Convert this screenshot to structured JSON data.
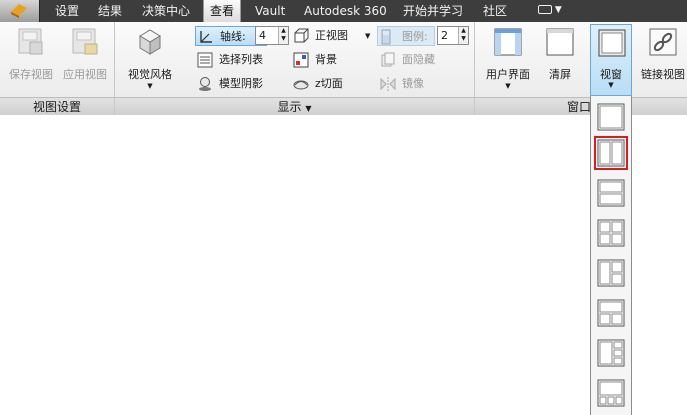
{
  "menu": {
    "items": [
      "设置",
      "结果",
      "决策中心",
      "查看",
      "Vault",
      "Autodesk 360",
      "开始并学习",
      "社区"
    ],
    "active": "查看"
  },
  "panels": {
    "view_settings": {
      "title": "视图设置",
      "save_view": "保存视图",
      "apply_view": "应用视图"
    },
    "display": {
      "title": "显示",
      "visual_style": "视觉风格",
      "axes_label": "轴线:",
      "axes_value": "4",
      "front_view": "正视图",
      "legend_label": "图例:",
      "legend_value": "2",
      "select_list": "选择列表",
      "background": "背景",
      "hide": "面隐藏",
      "model_shadow": "模型阴影",
      "z_slice": "z切面",
      "mirror": "镜像"
    },
    "window": {
      "title": "窗口",
      "user_interface": "用户界面",
      "clean_screen": "清屏",
      "viewport": "视窗",
      "link_views": "链接视图"
    }
  },
  "viewport_dropdown": {
    "layouts": [
      "single",
      "two-vertical",
      "two-horizontal",
      "four-grid",
      "three-left-large",
      "three-top-large",
      "four-left-large",
      "four-bottom-small"
    ],
    "selected": "two-vertical"
  },
  "colors": {
    "menubar": "#3d3d3d",
    "selection_border": "#d02020",
    "active_button": "#b9ddf5"
  }
}
